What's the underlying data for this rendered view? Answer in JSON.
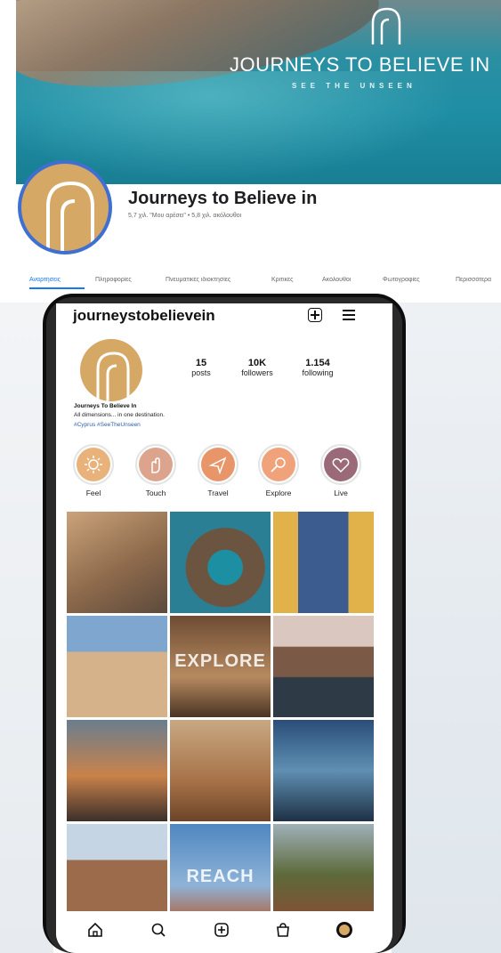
{
  "cover": {
    "headline": "JOURNEYS TO BELIEVE IN",
    "tagline": "SEE THE UNSEEN",
    "colors": {
      "sea": "#1f8ea5",
      "rock": "#b59f86"
    }
  },
  "page": {
    "name": "Journeys to Believe in",
    "meta": "5,7 χιλ. \"Μου αρέσει\" • 5,8 χιλ. ακόλουθοι",
    "avatar_color": "#d6a866",
    "avatar_border": "#3f6fd1"
  },
  "tabs": [
    {
      "label": "Αναρτήσεις",
      "active": true
    },
    {
      "label": "Πληροφορίες",
      "active": false
    },
    {
      "label": "Πνευματικές ιδιοκτησίες",
      "active": false
    },
    {
      "label": "Κριτικές",
      "active": false
    },
    {
      "label": "Ακόλουθοι",
      "active": false
    },
    {
      "label": "Φωτογραφίες",
      "active": false
    },
    {
      "label": "Περισσότερα",
      "active": false
    }
  ],
  "instagram": {
    "username": "journeystobelievein",
    "stats": [
      {
        "num": "15",
        "label": "posts"
      },
      {
        "num": "10K",
        "label": "followers"
      },
      {
        "num": "1.154",
        "label": "following"
      }
    ],
    "bio": {
      "name": "Journeys To Believe In",
      "line": "All dimensions... in one destination.",
      "tags": "#Cyprus #SeeTheUnseen"
    },
    "highlights": [
      {
        "label": "Feel",
        "icon": "sun-icon",
        "color": "#e8b27a"
      },
      {
        "label": "Touch",
        "icon": "hand-icon",
        "color": "#dca48c"
      },
      {
        "label": "Travel",
        "icon": "plane-icon",
        "color": "#e8956a"
      },
      {
        "label": "Explore",
        "icon": "magnifier-icon",
        "color": "#f0a37a"
      },
      {
        "label": "Live",
        "icon": "heart-icon",
        "color": "#9b6a79"
      }
    ],
    "grid_overlays": [
      "EXPLORE",
      "REACH"
    ],
    "nav": [
      "home-icon",
      "search-icon",
      "add-post-icon",
      "shop-icon",
      "profile-icon"
    ]
  }
}
